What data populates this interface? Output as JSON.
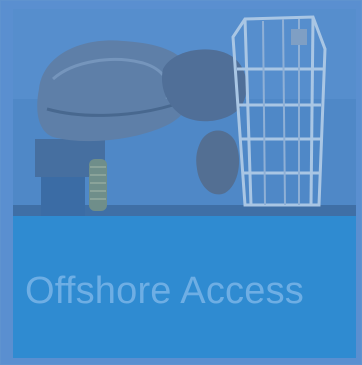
{
  "tile": {
    "title": "Offshore Access",
    "image_icon": "gangway-crane-photo",
    "colors": {
      "frame": "#5a8fd0",
      "banner": "#2f8bd1",
      "title_text": "#6eaee4",
      "photo_tint": "#4d86c6"
    }
  }
}
